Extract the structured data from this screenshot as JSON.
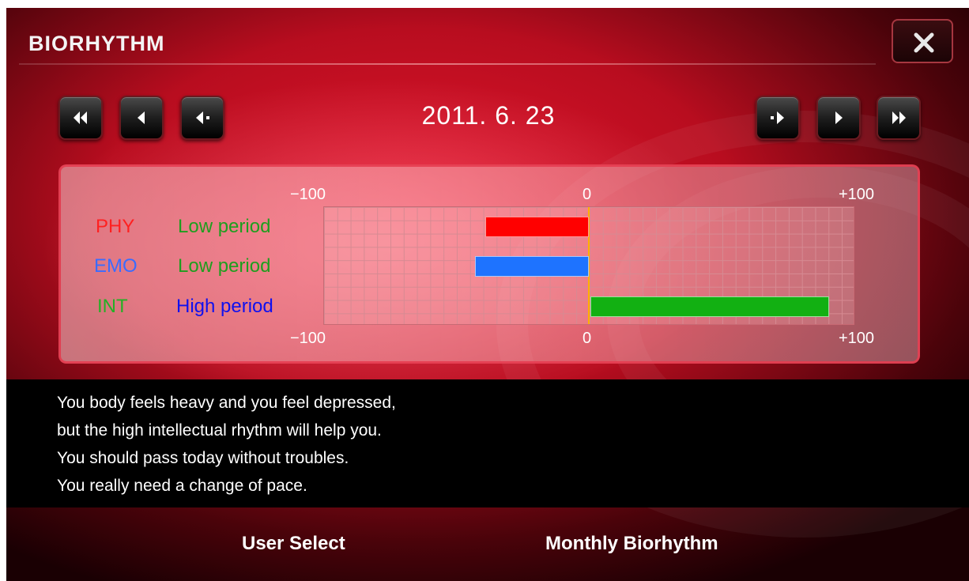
{
  "window": {
    "title": "BIORHYTHM"
  },
  "date": "2011. 6. 23",
  "chart": {
    "top_axis": {
      "min_label": "−100",
      "zero_label": "0",
      "max_label": "+100"
    },
    "bottom_axis": {
      "min_label": "−100",
      "zero_label": "0",
      "max_label": "+100"
    },
    "rows": [
      {
        "label": "PHY",
        "status": "Low period"
      },
      {
        "label": "EMO",
        "status": "Low period"
      },
      {
        "label": "INT",
        "status": "High period"
      }
    ]
  },
  "chart_data": {
    "type": "bar",
    "orientation": "horizontal",
    "categories": [
      "PHY",
      "EMO",
      "INT"
    ],
    "values": [
      -39,
      -43,
      90
    ],
    "xlim": [
      -100,
      100
    ],
    "grid": true
  },
  "colors": {
    "phy": "#ff0000",
    "emo": "#1e73ff",
    "int": "#12b012",
    "phy_label": "#ff2020",
    "emo_label": "#3a6cff",
    "int_label": "#25b025",
    "low_status": "#1e9e1e",
    "high_status": "#1010ee"
  },
  "message": {
    "lines": [
      "You body feels heavy and you feel depressed,",
      "but the high intellectual rhythm will help you.",
      "You should pass today without troubles.",
      "You really need a change of pace."
    ]
  },
  "buttons": {
    "user_select": "User Select",
    "monthly_biorhythm": "Monthly Biorhythm"
  },
  "icons": {
    "close": "close-icon",
    "first": "fast-rewind-icon",
    "prev": "previous-icon",
    "prev_step": "step-back-icon",
    "next_step": "step-forward-icon",
    "next": "next-icon",
    "last": "fast-forward-icon"
  }
}
